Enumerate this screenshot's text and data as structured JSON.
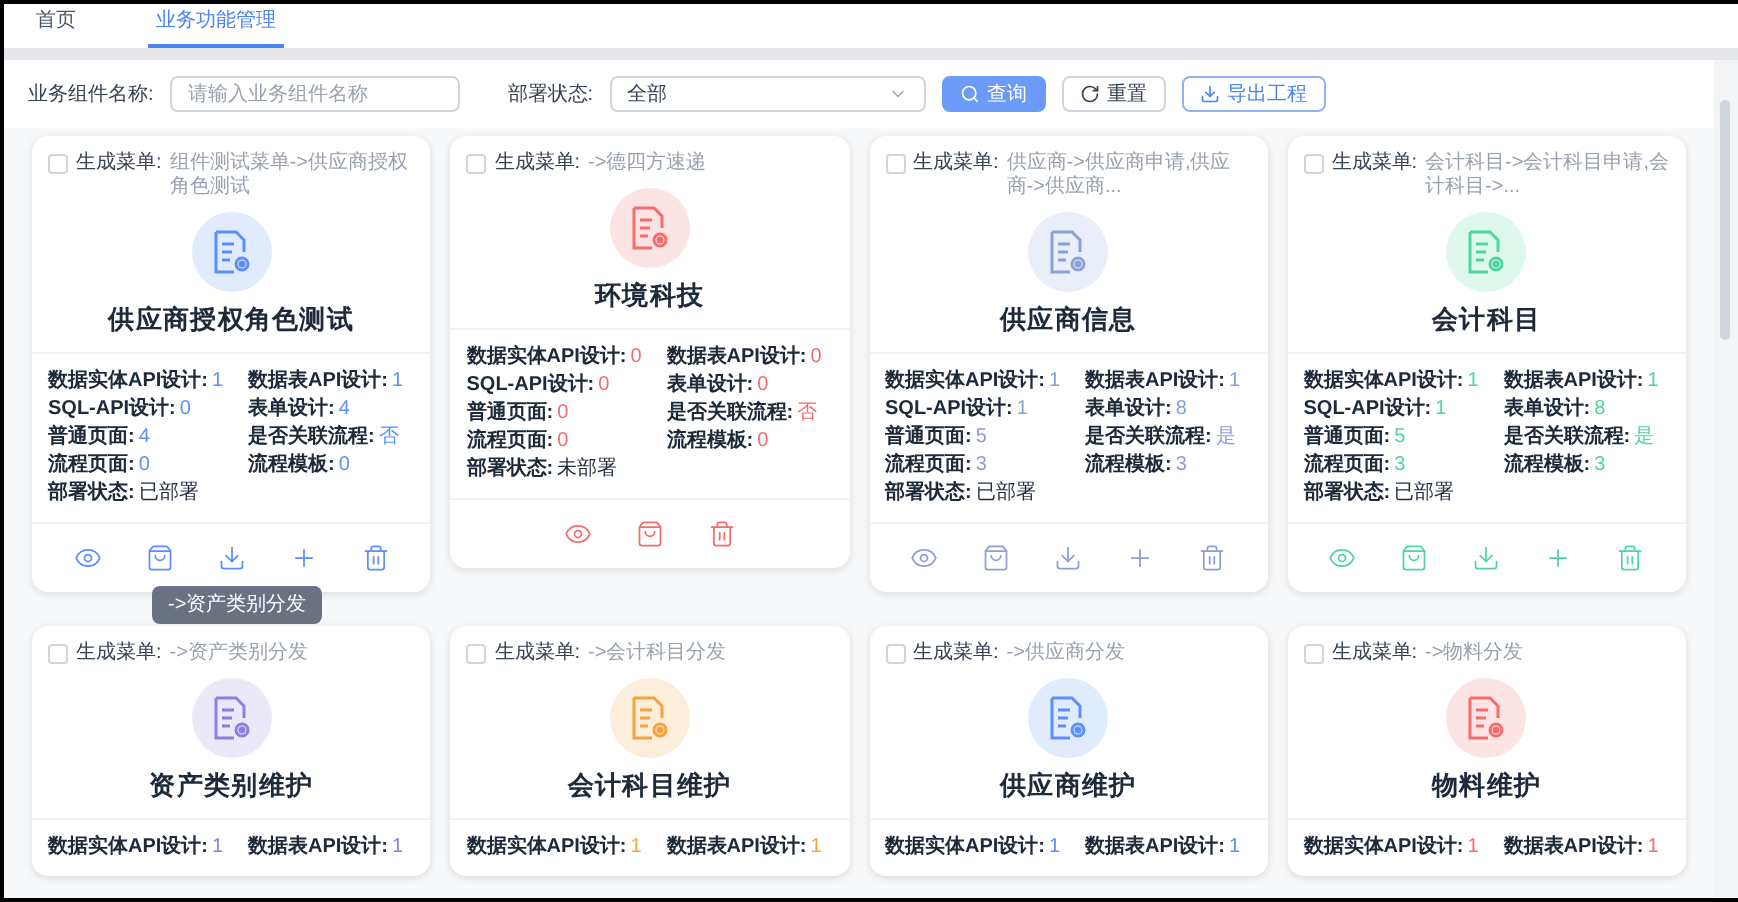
{
  "tabs": [
    {
      "label": "首页",
      "selected": false
    },
    {
      "label": "业务功能管理",
      "selected": true
    }
  ],
  "filters": {
    "name_label": "业务组件名称:",
    "name_placeholder": "请输入业务组件名称",
    "status_label": "部署状态:",
    "status_value": "全部",
    "buttons": [
      {
        "kind": "search",
        "label": "查询"
      },
      {
        "kind": "reset",
        "label": "重置"
      },
      {
        "kind": "export",
        "label": "导出工程"
      }
    ]
  },
  "tooltip": "->资产类别分发",
  "cards": [
    {
      "color": "#5b8ff9",
      "menu_label": "生成菜单:",
      "menu_path": "组件测试菜单->供应商授权角色测试",
      "checked": false,
      "title": "供应商授权角色测试",
      "stats": [
        {
          "label": "数据实体API设计:",
          "value": "1"
        },
        {
          "label": "数据表API设计:",
          "value": "1"
        },
        {
          "label": "SQL-API设计:",
          "value": "0"
        },
        {
          "label": "表单设计:",
          "value": "4"
        },
        {
          "label": "普通页面:",
          "value": "4"
        },
        {
          "label": "是否关联流程:",
          "value": "否"
        },
        {
          "label": "流程页面:",
          "value": "0"
        },
        {
          "label": "流程模板:",
          "value": "0"
        }
      ],
      "deploy_label": "部署状态:",
      "deploy_value": "已部署",
      "actions": [
        {
          "kind": "view"
        },
        {
          "kind": "publish"
        },
        {
          "kind": "download"
        },
        {
          "kind": "add"
        },
        {
          "kind": "delete"
        }
      ]
    },
    {
      "color": "#f56c6c",
      "menu_label": "生成菜单:",
      "menu_path": "->德四方速递",
      "checked": false,
      "title": "环境科技",
      "stats": [
        {
          "label": "数据实体API设计:",
          "value": "0"
        },
        {
          "label": "数据表API设计:",
          "value": "0"
        },
        {
          "label": "SQL-API设计:",
          "value": "0"
        },
        {
          "label": "表单设计:",
          "value": "0"
        },
        {
          "label": "普通页面:",
          "value": "0"
        },
        {
          "label": "是否关联流程:",
          "value": "否"
        },
        {
          "label": "流程页面:",
          "value": "0"
        },
        {
          "label": "流程模板:",
          "value": "0"
        }
      ],
      "deploy_label": "部署状态:",
      "deploy_value": "未部署",
      "actions": [
        {
          "kind": "view"
        },
        {
          "kind": "publish"
        },
        {
          "kind": "delete"
        }
      ]
    },
    {
      "color": "#8c9fd6",
      "menu_label": "生成菜单:",
      "menu_path": "供应商->供应商申请,供应商->供应商...",
      "checked": false,
      "title": "供应商信息",
      "stats": [
        {
          "label": "数据实体API设计:",
          "value": "1"
        },
        {
          "label": "数据表API设计:",
          "value": "1"
        },
        {
          "label": "SQL-API设计:",
          "value": "1"
        },
        {
          "label": "表单设计:",
          "value": "8"
        },
        {
          "label": "普通页面:",
          "value": "5"
        },
        {
          "label": "是否关联流程:",
          "value": "是"
        },
        {
          "label": "流程页面:",
          "value": "3"
        },
        {
          "label": "流程模板:",
          "value": "3"
        }
      ],
      "deploy_label": "部署状态:",
      "deploy_value": "已部署",
      "actions": [
        {
          "kind": "view"
        },
        {
          "kind": "publish"
        },
        {
          "kind": "download"
        },
        {
          "kind": "add"
        },
        {
          "kind": "delete"
        }
      ]
    },
    {
      "color": "#4fd6a0",
      "menu_label": "生成菜单:",
      "menu_path": "会计科目->会计科目申请,会计科目->...",
      "checked": false,
      "title": "会计科目",
      "stats": [
        {
          "label": "数据实体API设计:",
          "value": "1"
        },
        {
          "label": "数据表API设计:",
          "value": "1"
        },
        {
          "label": "SQL-API设计:",
          "value": "1"
        },
        {
          "label": "表单设计:",
          "value": "8"
        },
        {
          "label": "普通页面:",
          "value": "5"
        },
        {
          "label": "是否关联流程:",
          "value": "是"
        },
        {
          "label": "流程页面:",
          "value": "3"
        },
        {
          "label": "流程模板:",
          "value": "3"
        }
      ],
      "deploy_label": "部署状态:",
      "deploy_value": "已部署",
      "actions": [
        {
          "kind": "view"
        },
        {
          "kind": "publish"
        },
        {
          "kind": "download"
        },
        {
          "kind": "add"
        },
        {
          "kind": "delete"
        }
      ]
    },
    {
      "color": "#8d7ee0",
      "menu_label": "生成菜单:",
      "menu_path": "->资产类别分发",
      "checked": false,
      "title": "资产类别维护",
      "stats": [
        {
          "label": "数据实体API设计:",
          "value": "1"
        },
        {
          "label": "数据表API设计:",
          "value": "1"
        }
      ]
    },
    {
      "color": "#f5a23c",
      "menu_label": "生成菜单:",
      "menu_path": "->会计科目分发",
      "checked": false,
      "title": "会计科目维护",
      "stats": [
        {
          "label": "数据实体API设计:",
          "value": "1"
        },
        {
          "label": "数据表API设计:",
          "value": "1"
        }
      ]
    },
    {
      "color": "#5b8ff9",
      "menu_label": "生成菜单:",
      "menu_path": "->供应商分发",
      "checked": false,
      "title": "供应商维护",
      "stats": [
        {
          "label": "数据实体API设计:",
          "value": "1"
        },
        {
          "label": "数据表API设计:",
          "value": "1"
        }
      ]
    },
    {
      "color": "#f56c6c",
      "menu_label": "生成菜单:",
      "menu_path": "->物料分发",
      "checked": false,
      "title": "物料维护",
      "stats": [
        {
          "label": "数据实体API设计:",
          "value": "1"
        },
        {
          "label": "数据表API设计:",
          "value": "1"
        }
      ]
    }
  ]
}
